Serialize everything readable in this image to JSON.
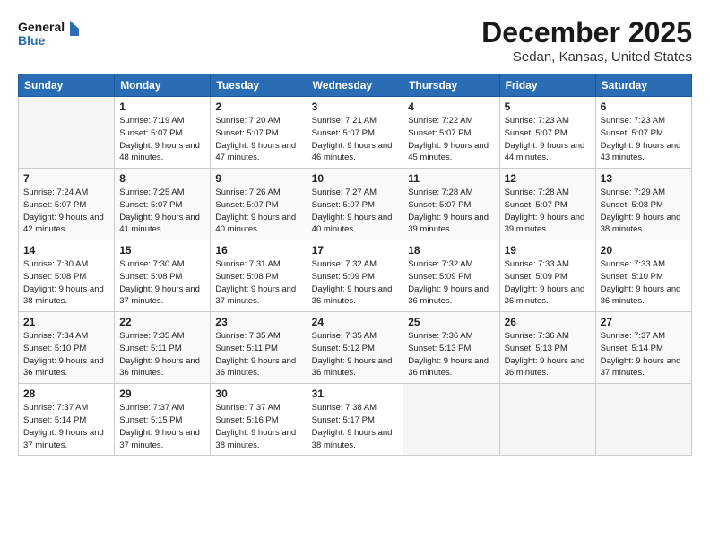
{
  "logo": {
    "line1": "General",
    "line2": "Blue"
  },
  "title": "December 2025",
  "subtitle": "Sedan, Kansas, United States",
  "days_header": [
    "Sunday",
    "Monday",
    "Tuesday",
    "Wednesday",
    "Thursday",
    "Friday",
    "Saturday"
  ],
  "weeks": [
    [
      {
        "num": "",
        "empty": true
      },
      {
        "num": "1",
        "sunrise": "7:19 AM",
        "sunset": "5:07 PM",
        "daylight": "9 hours and 48 minutes."
      },
      {
        "num": "2",
        "sunrise": "7:20 AM",
        "sunset": "5:07 PM",
        "daylight": "9 hours and 47 minutes."
      },
      {
        "num": "3",
        "sunrise": "7:21 AM",
        "sunset": "5:07 PM",
        "daylight": "9 hours and 46 minutes."
      },
      {
        "num": "4",
        "sunrise": "7:22 AM",
        "sunset": "5:07 PM",
        "daylight": "9 hours and 45 minutes."
      },
      {
        "num": "5",
        "sunrise": "7:23 AM",
        "sunset": "5:07 PM",
        "daylight": "9 hours and 44 minutes."
      },
      {
        "num": "6",
        "sunrise": "7:23 AM",
        "sunset": "5:07 PM",
        "daylight": "9 hours and 43 minutes."
      }
    ],
    [
      {
        "num": "7",
        "sunrise": "7:24 AM",
        "sunset": "5:07 PM",
        "daylight": "9 hours and 42 minutes."
      },
      {
        "num": "8",
        "sunrise": "7:25 AM",
        "sunset": "5:07 PM",
        "daylight": "9 hours and 41 minutes."
      },
      {
        "num": "9",
        "sunrise": "7:26 AM",
        "sunset": "5:07 PM",
        "daylight": "9 hours and 40 minutes."
      },
      {
        "num": "10",
        "sunrise": "7:27 AM",
        "sunset": "5:07 PM",
        "daylight": "9 hours and 40 minutes."
      },
      {
        "num": "11",
        "sunrise": "7:28 AM",
        "sunset": "5:07 PM",
        "daylight": "9 hours and 39 minutes."
      },
      {
        "num": "12",
        "sunrise": "7:28 AM",
        "sunset": "5:07 PM",
        "daylight": "9 hours and 39 minutes."
      },
      {
        "num": "13",
        "sunrise": "7:29 AM",
        "sunset": "5:08 PM",
        "daylight": "9 hours and 38 minutes."
      }
    ],
    [
      {
        "num": "14",
        "sunrise": "7:30 AM",
        "sunset": "5:08 PM",
        "daylight": "9 hours and 38 minutes."
      },
      {
        "num": "15",
        "sunrise": "7:30 AM",
        "sunset": "5:08 PM",
        "daylight": "9 hours and 37 minutes."
      },
      {
        "num": "16",
        "sunrise": "7:31 AM",
        "sunset": "5:08 PM",
        "daylight": "9 hours and 37 minutes."
      },
      {
        "num": "17",
        "sunrise": "7:32 AM",
        "sunset": "5:09 PM",
        "daylight": "9 hours and 36 minutes."
      },
      {
        "num": "18",
        "sunrise": "7:32 AM",
        "sunset": "5:09 PM",
        "daylight": "9 hours and 36 minutes."
      },
      {
        "num": "19",
        "sunrise": "7:33 AM",
        "sunset": "5:09 PM",
        "daylight": "9 hours and 36 minutes."
      },
      {
        "num": "20",
        "sunrise": "7:33 AM",
        "sunset": "5:10 PM",
        "daylight": "9 hours and 36 minutes."
      }
    ],
    [
      {
        "num": "21",
        "sunrise": "7:34 AM",
        "sunset": "5:10 PM",
        "daylight": "9 hours and 36 minutes."
      },
      {
        "num": "22",
        "sunrise": "7:35 AM",
        "sunset": "5:11 PM",
        "daylight": "9 hours and 36 minutes."
      },
      {
        "num": "23",
        "sunrise": "7:35 AM",
        "sunset": "5:11 PM",
        "daylight": "9 hours and 36 minutes."
      },
      {
        "num": "24",
        "sunrise": "7:35 AM",
        "sunset": "5:12 PM",
        "daylight": "9 hours and 36 minutes."
      },
      {
        "num": "25",
        "sunrise": "7:36 AM",
        "sunset": "5:13 PM",
        "daylight": "9 hours and 36 minutes."
      },
      {
        "num": "26",
        "sunrise": "7:36 AM",
        "sunset": "5:13 PM",
        "daylight": "9 hours and 36 minutes."
      },
      {
        "num": "27",
        "sunrise": "7:37 AM",
        "sunset": "5:14 PM",
        "daylight": "9 hours and 37 minutes."
      }
    ],
    [
      {
        "num": "28",
        "sunrise": "7:37 AM",
        "sunset": "5:14 PM",
        "daylight": "9 hours and 37 minutes."
      },
      {
        "num": "29",
        "sunrise": "7:37 AM",
        "sunset": "5:15 PM",
        "daylight": "9 hours and 37 minutes."
      },
      {
        "num": "30",
        "sunrise": "7:37 AM",
        "sunset": "5:16 PM",
        "daylight": "9 hours and 38 minutes."
      },
      {
        "num": "31",
        "sunrise": "7:38 AM",
        "sunset": "5:17 PM",
        "daylight": "9 hours and 38 minutes."
      },
      {
        "num": "",
        "empty": true
      },
      {
        "num": "",
        "empty": true
      },
      {
        "num": "",
        "empty": true
      }
    ]
  ],
  "labels": {
    "sunrise_prefix": "Sunrise: ",
    "sunset_prefix": "Sunset: ",
    "daylight_prefix": "Daylight: "
  }
}
